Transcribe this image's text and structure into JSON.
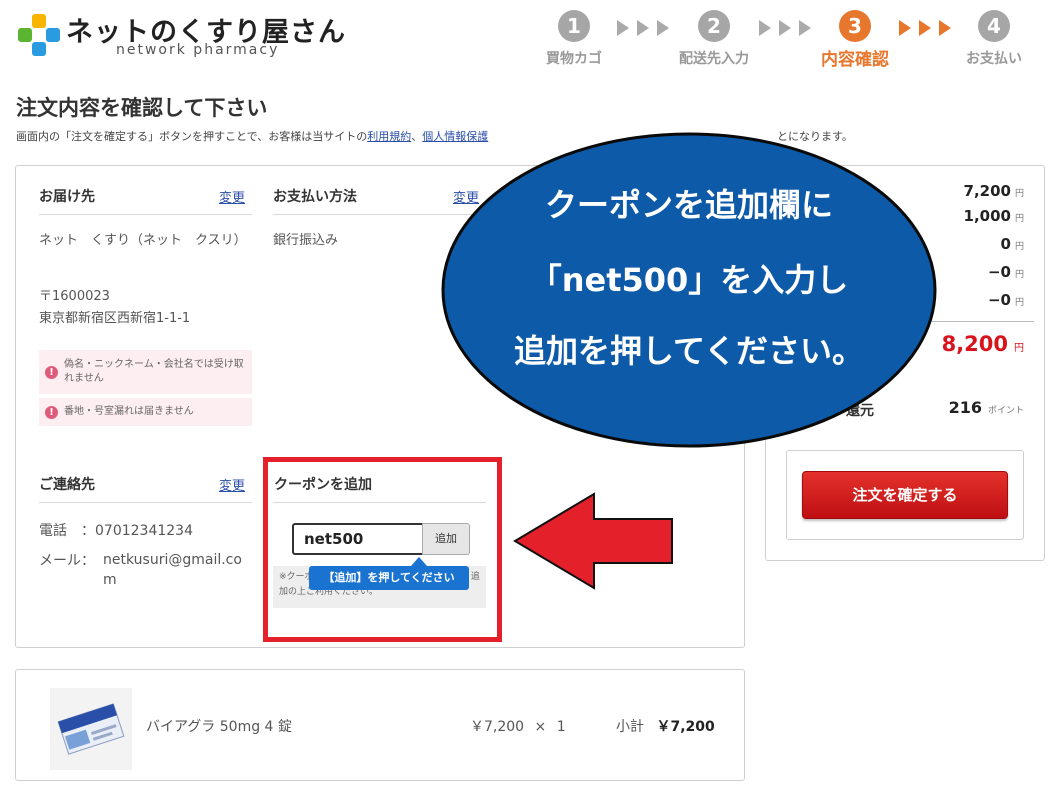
{
  "logo": {
    "title": "ネットのくすり屋さん",
    "subtitle": "network pharmacy"
  },
  "steps": [
    {
      "num": "1",
      "label": "買物カゴ",
      "state": "done"
    },
    {
      "num": "2",
      "label": "配送先入力",
      "state": "done"
    },
    {
      "num": "3",
      "label": "内容確認",
      "state": "active"
    },
    {
      "num": "4",
      "label": "お支払い",
      "state": "todo"
    }
  ],
  "page": {
    "title": "注文内容を確認して下さい",
    "desc_before": "画面内の「注文を確定する」ボタンを押すことで、お客様は当サイトの",
    "terms_link": "利用規約",
    "desc_sep": "、",
    "privacy_link": "個人情報保護",
    "desc_after": "とになります。"
  },
  "delivery": {
    "title": "お届け先",
    "change": "変更",
    "name": "ネット　くすり（ネット　クスリ）",
    "zip": "〒1600023",
    "address": "東京都新宿区西新宿1-1-1",
    "warn1": "偽名・ニックネーム・会社名では受け取れません",
    "warn2": "番地・号室漏れは届きません"
  },
  "payment": {
    "title": "お支払い方法",
    "change": "変更",
    "method": "銀行振込み"
  },
  "contact": {
    "title": "ご連絡先",
    "change": "変更",
    "phone_label": "電話　：",
    "phone": "07012341234",
    "mail_label": "メール：",
    "mail": "netkusuri@gmail.com"
  },
  "coupon": {
    "title": "クーポンを追加",
    "code": "net500",
    "add_button": "追加",
    "note": "※クーポンコードをご入力のうえ、「追加」より追加の上ご利用ください。",
    "tooltip": "【追加】を押してください"
  },
  "price": {
    "rows": [
      {
        "value": "7,200",
        "unit": "円"
      },
      {
        "value": "1,000",
        "unit": "円"
      },
      {
        "value": "0",
        "unit": "円"
      },
      {
        "value": "−0",
        "unit": "円"
      },
      {
        "value": "−0",
        "unit": "円"
      }
    ],
    "total": "8,200",
    "total_unit": "円",
    "points_label": "還元",
    "points": "216",
    "points_unit": "ポイント",
    "confirm_button": "注文を確定する"
  },
  "product": {
    "name": "バイアグラ 50mg 4 錠",
    "unit_price": "￥7,200",
    "times": "×",
    "qty": "1",
    "subtotal_label": "小計",
    "subtotal": "￥7,200",
    "box_label": "VIAGRA"
  },
  "callout": {
    "line1": "クーポンを追加欄に",
    "line2": "「net500」を入力し",
    "line3": "追加を押してください。"
  },
  "colors": {
    "accent_orange": "#e8772e",
    "callout_blue": "#0d5aa8",
    "highlight_red": "#e4202a",
    "total_red": "#d7141c",
    "link_blue": "#2a4fa8"
  }
}
